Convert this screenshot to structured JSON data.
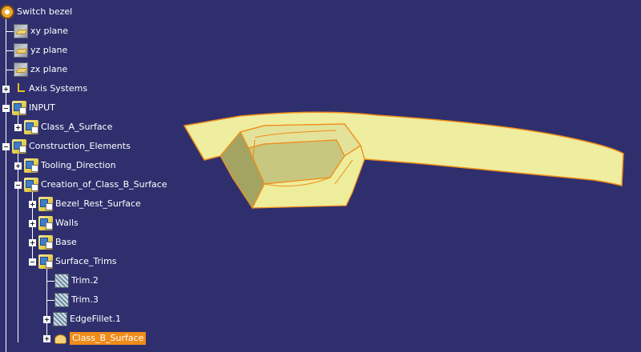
{
  "viewport": {
    "background": "#2f2f6e",
    "model": {
      "surface_color": "#efeea0",
      "edge_color": "#f08c18"
    }
  },
  "tree": {
    "root": "Switch bezel",
    "nodes": [
      {
        "label": "xy plane",
        "icon": "plane-icon"
      },
      {
        "label": "yz plane",
        "icon": "plane-icon"
      },
      {
        "label": "zx plane",
        "icon": "plane-icon"
      },
      {
        "label": "Axis Systems",
        "icon": "axis-system-icon"
      },
      {
        "label": "INPUT",
        "icon": "geometrical-set-icon"
      },
      {
        "label": "Class_A_Surface",
        "icon": "geometrical-set-icon"
      },
      {
        "label": "Construction_Elements",
        "icon": "geometrical-set-icon"
      },
      {
        "label": "Tooling_Direction",
        "icon": "geometrical-set-icon"
      },
      {
        "label": "Creation_of_Class_B_Surface",
        "icon": "geometrical-set-icon"
      },
      {
        "label": "Bezel_Rest_Surface",
        "icon": "geometrical-set-icon"
      },
      {
        "label": "Walls",
        "icon": "geometrical-set-icon"
      },
      {
        "label": "Base",
        "icon": "geometrical-set-icon"
      },
      {
        "label": "Surface_Trims",
        "icon": "geometrical-set-icon"
      },
      {
        "label": "Trim.2",
        "icon": "trim-icon"
      },
      {
        "label": "Trim.3",
        "icon": "trim-icon"
      },
      {
        "label": "EdgeFillet.1",
        "icon": "edge-fillet-icon"
      },
      {
        "label": "Class_B_Surface",
        "icon": "surface-icon",
        "selected": true
      }
    ]
  }
}
